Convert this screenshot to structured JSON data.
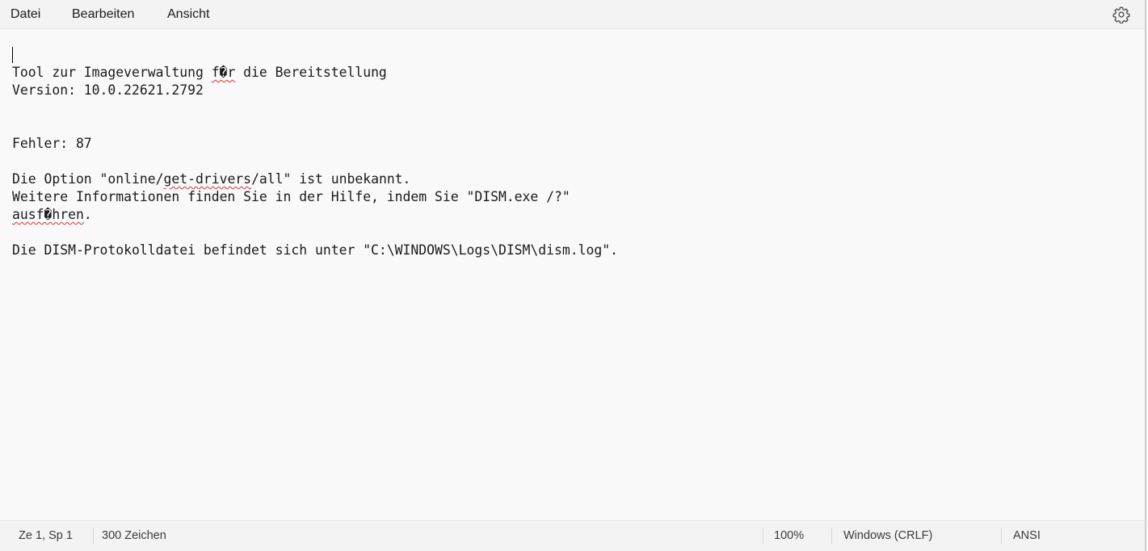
{
  "menu": {
    "file": "Datei",
    "edit": "Bearbeiten",
    "view": "Ansicht",
    "settings_icon": "gear-icon"
  },
  "document": {
    "lines": [
      {
        "parts": [
          {
            "text": ""
          }
        ]
      },
      {
        "parts": [
          {
            "text": "Tool zur Imageverwaltung "
          },
          {
            "text": "f�r",
            "typo": true
          },
          {
            "text": " die Bereitstellung"
          }
        ]
      },
      {
        "parts": [
          {
            "text": "Version: 10.0.22621.2792"
          }
        ]
      },
      {
        "parts": [
          {
            "text": ""
          }
        ]
      },
      {
        "parts": [
          {
            "text": ""
          }
        ]
      },
      {
        "parts": [
          {
            "text": "Fehler: 87"
          }
        ]
      },
      {
        "parts": [
          {
            "text": ""
          }
        ]
      },
      {
        "parts": [
          {
            "text": "Die Option \"online/"
          },
          {
            "text": "get-drivers",
            "typo": true
          },
          {
            "text": "/all\" ist unbekannt."
          }
        ]
      },
      {
        "parts": [
          {
            "text": "Weitere Informationen finden Sie in der Hilfe, indem Sie \"DISM.exe /?\""
          }
        ]
      },
      {
        "parts": [
          {
            "text": "ausf�hren",
            "typo": true
          },
          {
            "text": "."
          }
        ]
      },
      {
        "parts": [
          {
            "text": ""
          }
        ]
      },
      {
        "parts": [
          {
            "text": "Die DISM-Protokolldatei befindet sich unter \"C:\\WINDOWS\\Logs\\DISM\\dism.log\"."
          }
        ]
      }
    ]
  },
  "status": {
    "position": "Ze 1, Sp 1",
    "char_count": "300 Zeichen",
    "zoom": "100%",
    "line_ending": "Windows (CRLF)",
    "encoding": "ANSI"
  }
}
